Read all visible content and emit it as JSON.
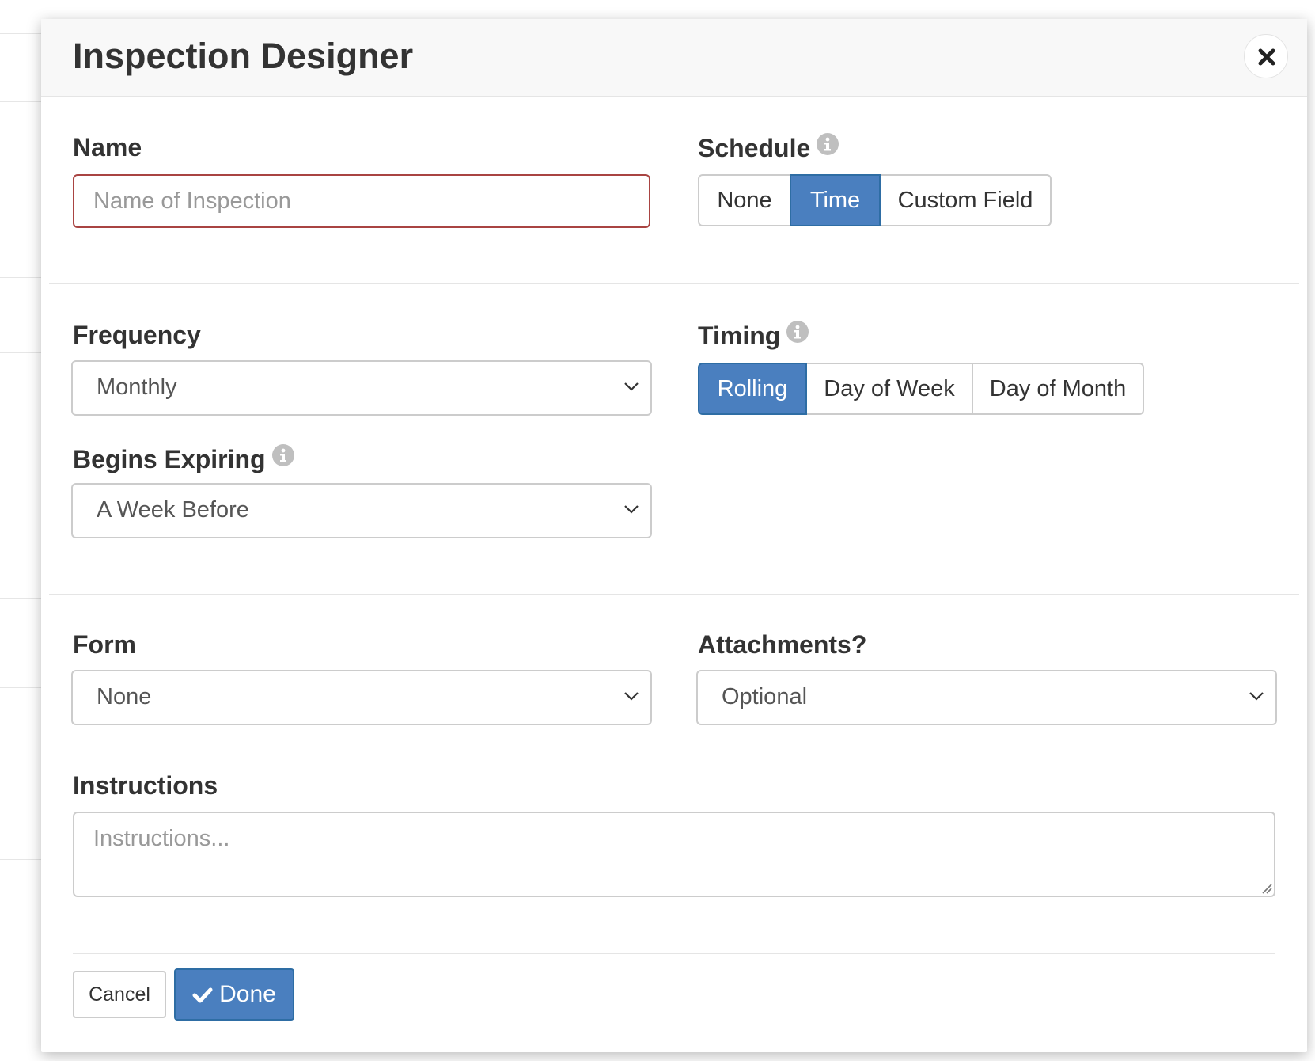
{
  "modal": {
    "title": "Inspection Designer",
    "close_icon": "close-icon"
  },
  "name": {
    "label": "Name",
    "placeholder": "Name of Inspection",
    "value": ""
  },
  "schedule": {
    "label": "Schedule",
    "info_icon": "info-icon",
    "options": [
      "None",
      "Time",
      "Custom Field"
    ],
    "selected": "Time"
  },
  "frequency": {
    "label": "Frequency",
    "value": "Monthly"
  },
  "timing": {
    "label": "Timing",
    "info_icon": "info-icon",
    "options": [
      "Rolling",
      "Day of Week",
      "Day of Month"
    ],
    "selected": "Rolling"
  },
  "begins_expiring": {
    "label": "Begins Expiring",
    "info_icon": "info-icon",
    "value": "A Week Before"
  },
  "form": {
    "label": "Form",
    "value": "None"
  },
  "attachments": {
    "label": "Attachments?",
    "value": "Optional"
  },
  "instructions": {
    "label": "Instructions",
    "placeholder": "Instructions...",
    "value": ""
  },
  "footer": {
    "cancel_label": "Cancel",
    "done_label": "Done",
    "done_icon": "check-icon"
  },
  "colors": {
    "primary": "#4a7fbf",
    "error_border": "#a94442",
    "label_text": "#333333"
  }
}
